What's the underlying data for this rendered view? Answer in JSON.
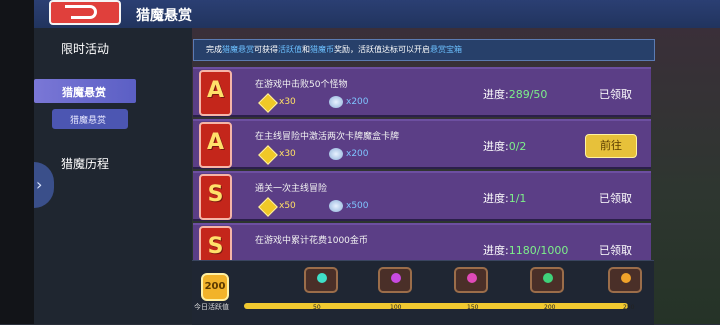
{
  "header": {
    "title": "猎魔悬赏"
  },
  "sidebar": {
    "items": [
      {
        "label": "限时活动"
      },
      {
        "label": "猎魔悬赏",
        "sub": "猎魔悬赏"
      },
      {
        "label": "猎魔历程"
      }
    ]
  },
  "notice": {
    "p1": "完成",
    "h1": "猎魔悬赏",
    "p2": "可获得",
    "h2": "活跃值",
    "p3": "和",
    "h3": "猎魔币",
    "p4": "奖励，活跃值达标可以开启",
    "h4": "悬赏宝箱"
  },
  "quests": [
    {
      "grade": "A",
      "title": "在游戏中击败50个怪物",
      "cube": "x30",
      "coin": "x200",
      "progress_label": "进度:",
      "progress": "289/50",
      "action": "已领取",
      "action_type": "claimed"
    },
    {
      "grade": "A",
      "title": "在主线冒险中激活两次卡牌魔盒卡牌",
      "cube": "x30",
      "coin": "x200",
      "progress_label": "进度:",
      "progress": "0/2",
      "action": "前往",
      "action_type": "goto"
    },
    {
      "grade": "S",
      "title": "通关一次主线冒险",
      "cube": "x50",
      "coin": "x500",
      "progress_label": "进度:",
      "progress": "1/1",
      "action": "已领取",
      "action_type": "claimed"
    },
    {
      "grade": "S",
      "title": "在游戏中累计花费1000金币",
      "cube": "",
      "coin": "",
      "progress_label": "进度:",
      "progress": "1180/1000",
      "action": "已领取",
      "action_type": "claimed"
    }
  ],
  "activity": {
    "value": "200",
    "label": "今日活跃值",
    "fill_fraction": 1.0,
    "milestones": [
      "50",
      "100",
      "150",
      "200",
      "250"
    ],
    "gem_colors": [
      "#3fe0c8",
      "#c84ae0",
      "#e04ab8",
      "#3fd27a",
      "#f0a22a"
    ]
  }
}
